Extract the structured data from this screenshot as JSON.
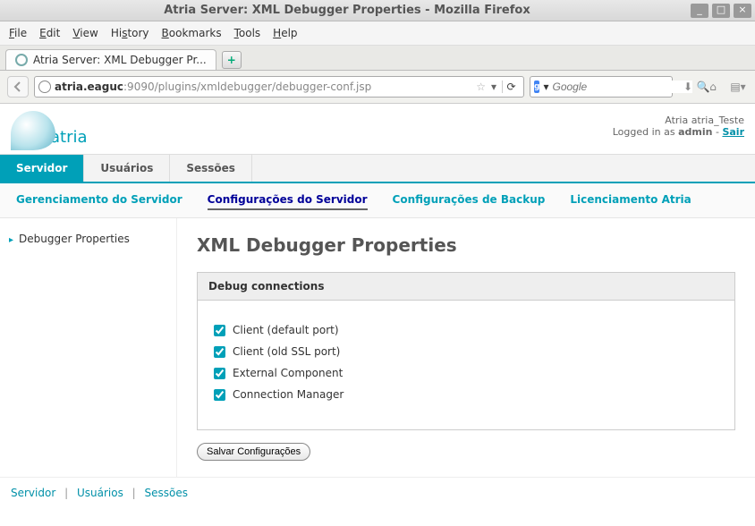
{
  "window": {
    "title": "Atria Server: XML Debugger Properties - Mozilla Firefox"
  },
  "menubar": {
    "file": "File",
    "edit": "Edit",
    "view": "View",
    "history": "History",
    "bookmarks": "Bookmarks",
    "tools": "Tools",
    "help": "Help"
  },
  "tab": {
    "label": "Atria Server: XML Debugger Pr..."
  },
  "url": {
    "host": "atria.eaguc",
    "rest": ":9090/plugins/xmldebugger/debugger-conf.jsp"
  },
  "search": {
    "engine_label": "g",
    "placeholder": "Google"
  },
  "header": {
    "logo_text": "atria",
    "user_line1": "Atria atria_Teste",
    "user_line2_prefix": "Logged in as ",
    "user_name": "admin",
    "user_sep": " - ",
    "logout": "Sair"
  },
  "main_nav": {
    "servidor": "Servidor",
    "usuarios": "Usuários",
    "sessoes": "Sessões"
  },
  "sub_nav": {
    "gerenciamento": "Gerenciamento do Servidor",
    "configuracoes": "Configurações do Servidor",
    "backup": "Configurações de Backup",
    "licenciamento": "Licenciamento Atria"
  },
  "sidebar": {
    "debugger": "Debugger Properties"
  },
  "content": {
    "title": "XML Debugger Properties",
    "panel_title": "Debug connections",
    "options": [
      {
        "label": "Client (default port)",
        "checked": true
      },
      {
        "label": "Client (old SSL port)",
        "checked": true
      },
      {
        "label": "External Component",
        "checked": true
      },
      {
        "label": "Connection Manager",
        "checked": true
      }
    ],
    "save_button": "Salvar Configurações"
  },
  "footer": {
    "servidor": "Servidor",
    "usuarios": "Usuários",
    "sessoes": "Sessões"
  }
}
